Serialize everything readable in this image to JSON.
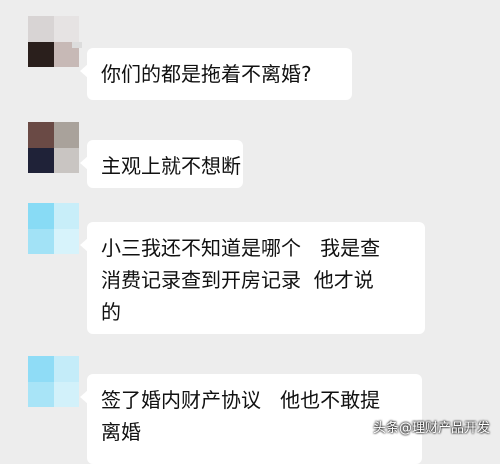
{
  "messages": [
    {
      "avatar_colors": [
        "#d8d4d4",
        "#e6e3e3",
        "#2a1f1c",
        "#c7b9b6"
      ],
      "lines": [
        "你们的都是拖着不离婚?"
      ]
    },
    {
      "avatar_colors": [
        "#6a4a45",
        "#a9a29b",
        "#1f2238",
        "#c9c5c2"
      ],
      "lines": [
        "主观上就不想断"
      ]
    },
    {
      "avatar_colors": [
        "#88dbf5",
        "#c8eef9",
        "#a2e2f6",
        "#d7f3fb"
      ],
      "lines": [
        "小三我还不知道是哪个   我是查",
        "消费记录查到开房记录  他才说",
        "的"
      ]
    },
    {
      "avatar_colors": [
        "#8fdcf6",
        "#c4ecf9",
        "#a8e4f7",
        "#d2f1fa"
      ],
      "lines": [
        "签了婚内财产协议   他也不敢提",
        "离婚"
      ]
    }
  ],
  "watermark": "头条@理财产品开发"
}
